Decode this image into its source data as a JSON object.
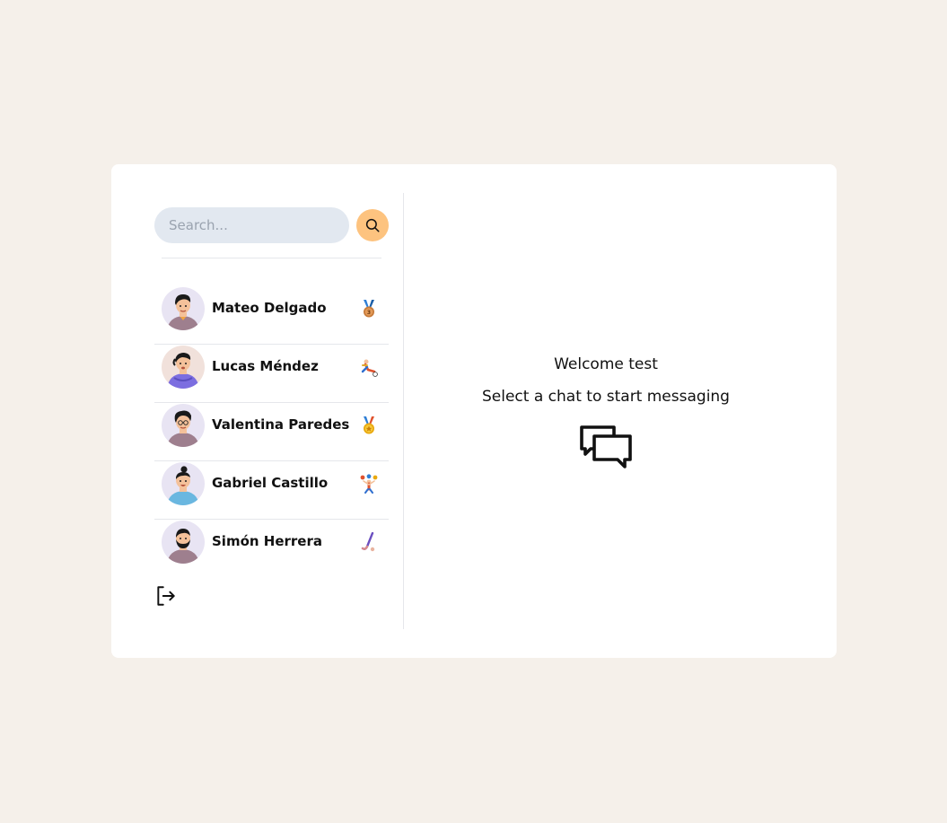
{
  "search": {
    "placeholder": "Search...",
    "button_icon": "search-icon"
  },
  "conversations": [
    {
      "name": "Mateo Delgado",
      "emoji": "3rd-place-medal-icon",
      "avatar_shirt": "#9e7f8e",
      "avatar_bg": "#e8e4f3"
    },
    {
      "name": "Lucas Méndez",
      "emoji": "soccer-kick-icon",
      "avatar_shirt": "#7c6ee0",
      "avatar_bg": "#f1e1db"
    },
    {
      "name": "Valentina Paredes",
      "emoji": "sports-medal-icon",
      "avatar_shirt": "#9e7f8e",
      "avatar_bg": "#e8e4f3"
    },
    {
      "name": "Gabriel Castillo",
      "emoji": "juggling-icon",
      "avatar_shirt": "#6ab7e0",
      "avatar_bg": "#e8e4f3"
    },
    {
      "name": "Simón Herrera",
      "emoji": "field-hockey-icon",
      "avatar_shirt": "#9e7f8e",
      "avatar_bg": "#e8e4f3"
    }
  ],
  "logout": {
    "icon": "logout-icon"
  },
  "welcome": {
    "title": "Welcome test",
    "subtitle": "Select a chat to start messaging",
    "icon": "chat-bubbles-icon"
  },
  "colors": {
    "page_background": "#f5f0ea",
    "card_background": "#ffffff",
    "search_field": "#e2e8f0",
    "search_button": "#fdc37f"
  }
}
